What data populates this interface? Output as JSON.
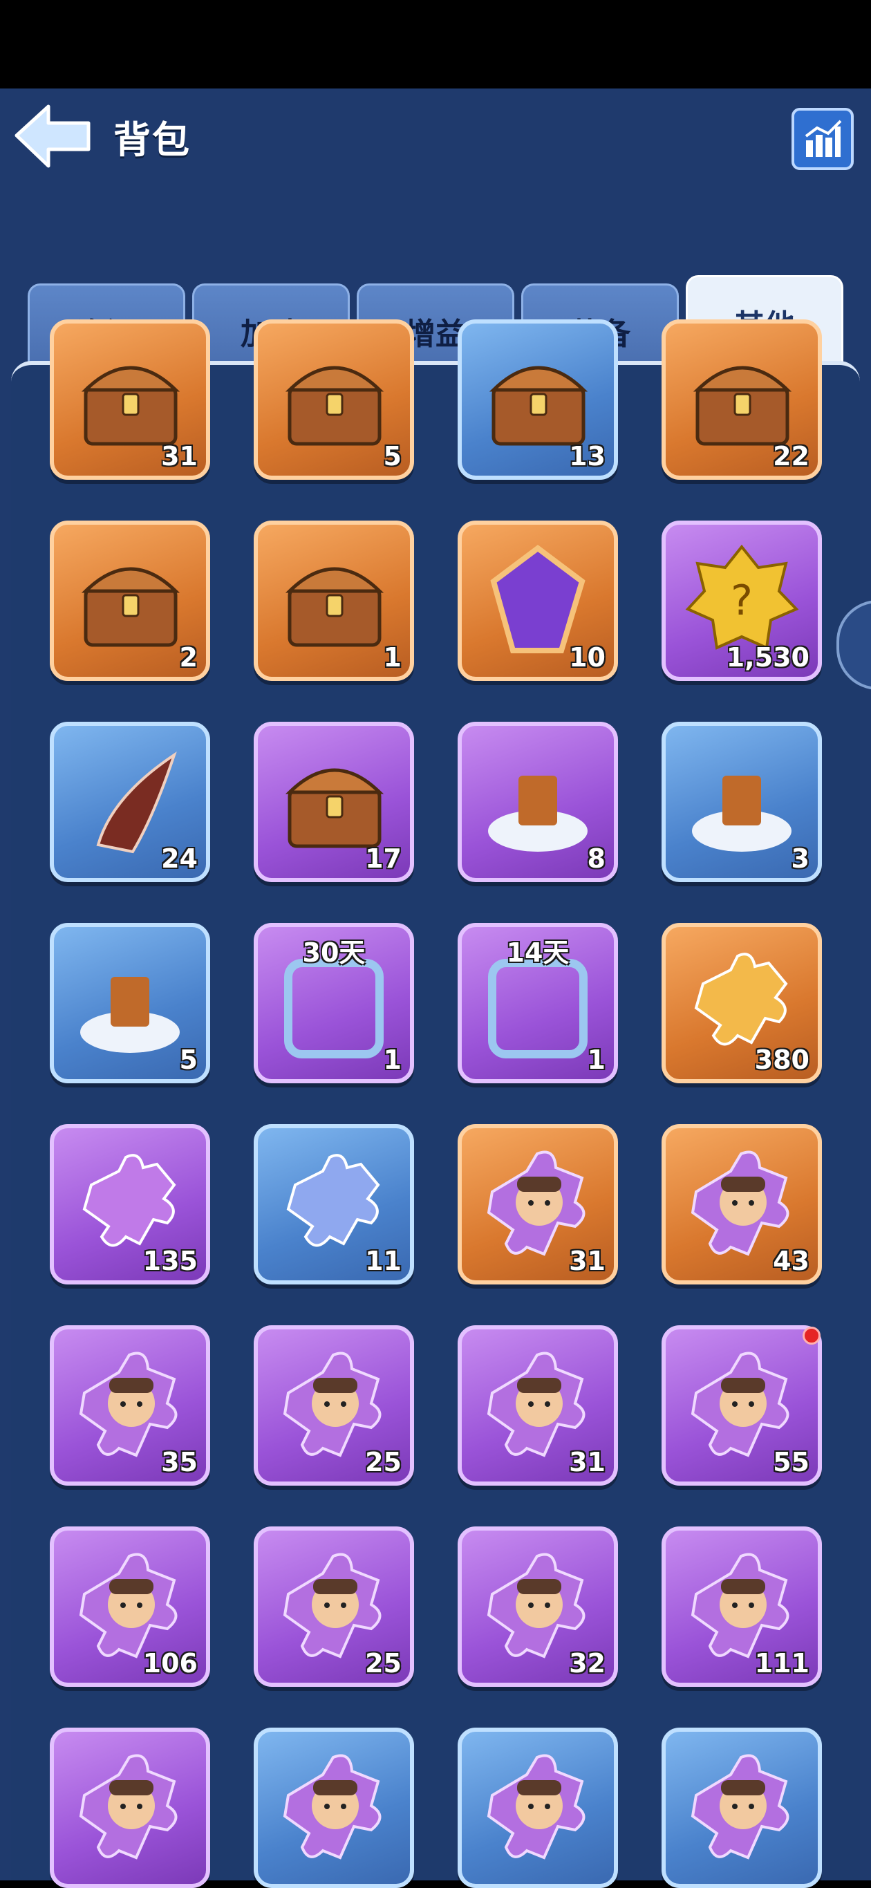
{
  "header": {
    "title": "背包"
  },
  "tabs": [
    {
      "label": "资源",
      "active": false
    },
    {
      "label": "加速",
      "active": false
    },
    {
      "label": "增益",
      "active": false
    },
    {
      "label": "装备",
      "active": false
    },
    {
      "label": "其他",
      "active": true
    }
  ],
  "colors": {
    "orange": "#d9782e",
    "blue": "#4a82cc",
    "purple": "#9a53d8",
    "panel": "#1e3a6c"
  },
  "items": [
    {
      "icon": "pet-treasure-chest-icon",
      "rarity": "orange",
      "count": "31"
    },
    {
      "icon": "silver-mystery-chest-icon",
      "rarity": "orange",
      "count": "5"
    },
    {
      "icon": "wooden-mystery-chest-icon",
      "rarity": "blue",
      "count": "13"
    },
    {
      "icon": "golden-treasure-chest-icon",
      "rarity": "orange",
      "count": "22"
    },
    {
      "icon": "cloth-treasure-chest-icon",
      "rarity": "orange",
      "count": "2"
    },
    {
      "icon": "treasure-chest-icon",
      "rarity": "orange",
      "count": "1"
    },
    {
      "icon": "purple-rune-gem-icon",
      "rarity": "orange",
      "count": "10"
    },
    {
      "icon": "gold-mystery-badge-icon",
      "rarity": "purple",
      "count": "1,530"
    },
    {
      "icon": "horn-icon",
      "rarity": "blue",
      "count": "24"
    },
    {
      "icon": "puzzle-chest-icon",
      "rarity": "purple",
      "count": "17"
    },
    {
      "icon": "building-relocate-icon",
      "rarity": "purple",
      "count": "8"
    },
    {
      "icon": "statue-relocate-icon",
      "rarity": "blue",
      "count": "3"
    },
    {
      "icon": "banner-relocate-icon",
      "rarity": "blue",
      "count": "5"
    },
    {
      "icon": "ocean-avatar-frame-icon",
      "rarity": "purple",
      "count": "1",
      "duration": "30天"
    },
    {
      "icon": "winter-avatar-frame-icon",
      "rarity": "purple",
      "count": "1",
      "duration": "14天"
    },
    {
      "icon": "orange-puzzle-piece-icon",
      "rarity": "orange",
      "count": "380"
    },
    {
      "icon": "purple-puzzle-piece-icon",
      "rarity": "purple",
      "count": "135"
    },
    {
      "icon": "blue-puzzle-piece-icon",
      "rarity": "blue",
      "count": "11"
    },
    {
      "icon": "hero-puzzle-miner-icon",
      "rarity": "orange",
      "count": "31"
    },
    {
      "icon": "hero-puzzle-pilot-icon",
      "rarity": "orange",
      "count": "43"
    },
    {
      "icon": "hero-puzzle-doctor-icon",
      "rarity": "purple",
      "count": "35"
    },
    {
      "icon": "hero-puzzle-nomad-icon",
      "rarity": "purple",
      "count": "25"
    },
    {
      "icon": "hero-puzzle-girl-icon",
      "rarity": "purple",
      "count": "31"
    },
    {
      "icon": "hero-puzzle-redhead-icon",
      "rarity": "purple",
      "count": "55",
      "badge": true
    },
    {
      "icon": "hero-puzzle-viking-icon",
      "rarity": "purple",
      "count": "106"
    },
    {
      "icon": "hero-puzzle-aviator-icon",
      "rarity": "purple",
      "count": "25"
    },
    {
      "icon": "hero-puzzle-chef-icon",
      "rarity": "purple",
      "count": "32"
    },
    {
      "icon": "hero-puzzle-captain-icon",
      "rarity": "purple",
      "count": "111"
    },
    {
      "icon": "hero-puzzle-rogue-icon",
      "rarity": "purple",
      "count": ""
    },
    {
      "icon": "hero-puzzle-blonde-icon",
      "rarity": "blue",
      "count": ""
    },
    {
      "icon": "hero-puzzle-mustache-icon",
      "rarity": "blue",
      "count": ""
    },
    {
      "icon": "hero-puzzle-goggles-icon",
      "rarity": "blue",
      "count": ""
    }
  ]
}
